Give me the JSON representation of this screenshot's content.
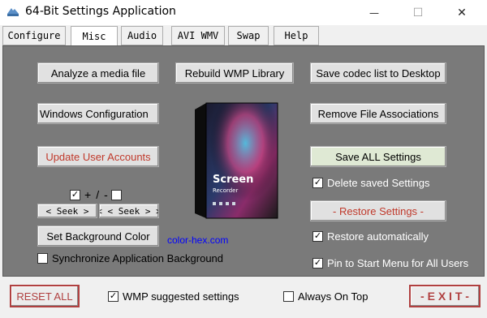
{
  "window": {
    "title": "64-Bit Settings Application",
    "controls": {
      "minimize": "—",
      "maximize": "☐",
      "close": "✕"
    }
  },
  "tabs": [
    {
      "label": "Configure"
    },
    {
      "label": "Misc"
    },
    {
      "label": "Audio"
    },
    {
      "label": "AVI WMV"
    },
    {
      "label": "Swap"
    },
    {
      "label": "Help"
    }
  ],
  "left": {
    "analyze": "Analyze a media file",
    "windows_config": "Windows Configuration",
    "update_accounts": "Update User Accounts",
    "plus": "+",
    "slash": "/",
    "minus": "-",
    "seek_fwd": "< Seek >",
    "seek_back": "< < Seek > >",
    "bg_color": "Set Background Color",
    "sync_bg": "Synchronize Application Background"
  },
  "center": {
    "rebuild": "Rebuild WMP Library",
    "link": "color-hex.com",
    "product_name": "Screen",
    "product_sub": "Recorder"
  },
  "right": {
    "save_codec": "Save codec list to Desktop",
    "remove_assoc": "Remove File Associations",
    "save_all": "Save ALL Settings",
    "delete_saved": "Delete saved Settings",
    "restore_settings": "- Restore Settings -",
    "restore_auto": "Restore automatically",
    "pin_start": "Pin to Start Menu for All Users"
  },
  "bottom": {
    "reset": "RESET ALL",
    "wmp_suggested": "WMP suggested settings",
    "always_on_top": "Always On Top",
    "exit": "- E X I T -"
  },
  "state": {
    "chk_plus": true,
    "chk_minus": false,
    "sync_bg": false,
    "delete_saved": true,
    "restore_auto": true,
    "pin_start": true,
    "wmp_suggested": true,
    "always_on_top": false
  }
}
